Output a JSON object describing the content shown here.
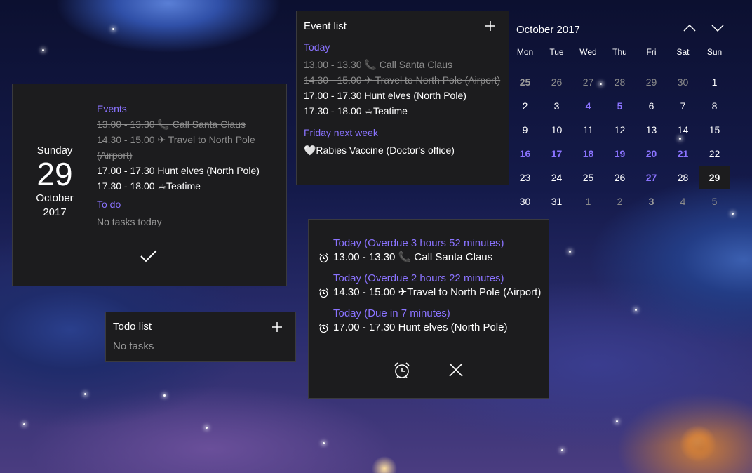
{
  "date_tile": {
    "day_of_week": "Sunday",
    "day": "29",
    "month": "October",
    "year": "2017",
    "events_heading": "Events",
    "events": [
      {
        "text": "13.00 - 13.30 📞 Call Santa Claus",
        "done": true
      },
      {
        "text": "14.30 - 15.00 ✈ Travel to North Pole (Airport)",
        "done": true
      },
      {
        "text": "17.00 - 17.30 Hunt elves (North Pole)",
        "done": false
      },
      {
        "text": "17.30 - 18.00 ☕Teatime",
        "done": false
      }
    ],
    "todo_heading": "To do",
    "todo_empty": "No tasks today"
  },
  "todo_list": {
    "title": "Todo list",
    "empty": "No tasks"
  },
  "event_list": {
    "title": "Event list",
    "today_heading": "Today",
    "today_events": [
      {
        "text": "13.00 - 13.30 📞 Call Santa Claus",
        "done": true
      },
      {
        "text": "14.30 - 15.00 ✈ Travel to North Pole (Airport)",
        "done": true
      },
      {
        "text": "17.00 - 17.30 Hunt elves (North Pole)",
        "done": false
      },
      {
        "text": "17.30 - 18.00 ☕Teatime",
        "done": false
      }
    ],
    "next_heading": "Friday next week",
    "next_events": [
      {
        "text": "🤍Rabies Vaccine (Doctor's office)",
        "done": false
      }
    ]
  },
  "calendar": {
    "month_title": "October 2017",
    "weekdays": [
      "Mon",
      "Tue",
      "Wed",
      "Thu",
      "Fri",
      "Sat",
      "Sun"
    ],
    "days": [
      {
        "d": "25",
        "s": "evdim"
      },
      {
        "d": "26",
        "s": "out"
      },
      {
        "d": "27",
        "s": "out"
      },
      {
        "d": "28",
        "s": "out"
      },
      {
        "d": "29",
        "s": "out"
      },
      {
        "d": "30",
        "s": "out"
      },
      {
        "d": "1",
        "s": ""
      },
      {
        "d": "2",
        "s": ""
      },
      {
        "d": "3",
        "s": ""
      },
      {
        "d": "4",
        "s": "ev"
      },
      {
        "d": "5",
        "s": "ev"
      },
      {
        "d": "6",
        "s": ""
      },
      {
        "d": "7",
        "s": ""
      },
      {
        "d": "8",
        "s": ""
      },
      {
        "d": "9",
        "s": ""
      },
      {
        "d": "10",
        "s": ""
      },
      {
        "d": "11",
        "s": ""
      },
      {
        "d": "12",
        "s": ""
      },
      {
        "d": "13",
        "s": ""
      },
      {
        "d": "14",
        "s": ""
      },
      {
        "d": "15",
        "s": ""
      },
      {
        "d": "16",
        "s": "ev"
      },
      {
        "d": "17",
        "s": "ev"
      },
      {
        "d": "18",
        "s": "ev"
      },
      {
        "d": "19",
        "s": "ev"
      },
      {
        "d": "20",
        "s": "ev"
      },
      {
        "d": "21",
        "s": "ev"
      },
      {
        "d": "22",
        "s": ""
      },
      {
        "d": "23",
        "s": ""
      },
      {
        "d": "24",
        "s": ""
      },
      {
        "d": "25",
        "s": ""
      },
      {
        "d": "26",
        "s": ""
      },
      {
        "d": "27",
        "s": "ev"
      },
      {
        "d": "28",
        "s": ""
      },
      {
        "d": "29",
        "s": "today"
      },
      {
        "d": "30",
        "s": ""
      },
      {
        "d": "31",
        "s": ""
      },
      {
        "d": "1",
        "s": "out"
      },
      {
        "d": "2",
        "s": "out"
      },
      {
        "d": "3",
        "s": "evdim"
      },
      {
        "d": "4",
        "s": "out"
      },
      {
        "d": "5",
        "s": "out"
      }
    ]
  },
  "reminder": {
    "items": [
      {
        "status": "Today (Overdue 3 hours 52 minutes)",
        "text": "13.00 - 13.30 📞 Call Santa Claus"
      },
      {
        "status": "Today (Overdue 2 hours 22 minutes)",
        "text": "14.30 - 15.00 ✈Travel to North Pole (Airport)"
      },
      {
        "status": "Today (Due in 7 minutes)",
        "text": "17.00 - 17.30 Hunt elves (North Pole)"
      }
    ]
  },
  "colors": {
    "accent": "#8a73ff",
    "panel": "#1c1c1e"
  },
  "icons": {
    "check": "checkmark-icon",
    "add": "plus-icon",
    "prev": "chevron-up-icon",
    "next": "chevron-down-icon",
    "alarm": "alarm-clock-icon",
    "close": "close-icon"
  }
}
